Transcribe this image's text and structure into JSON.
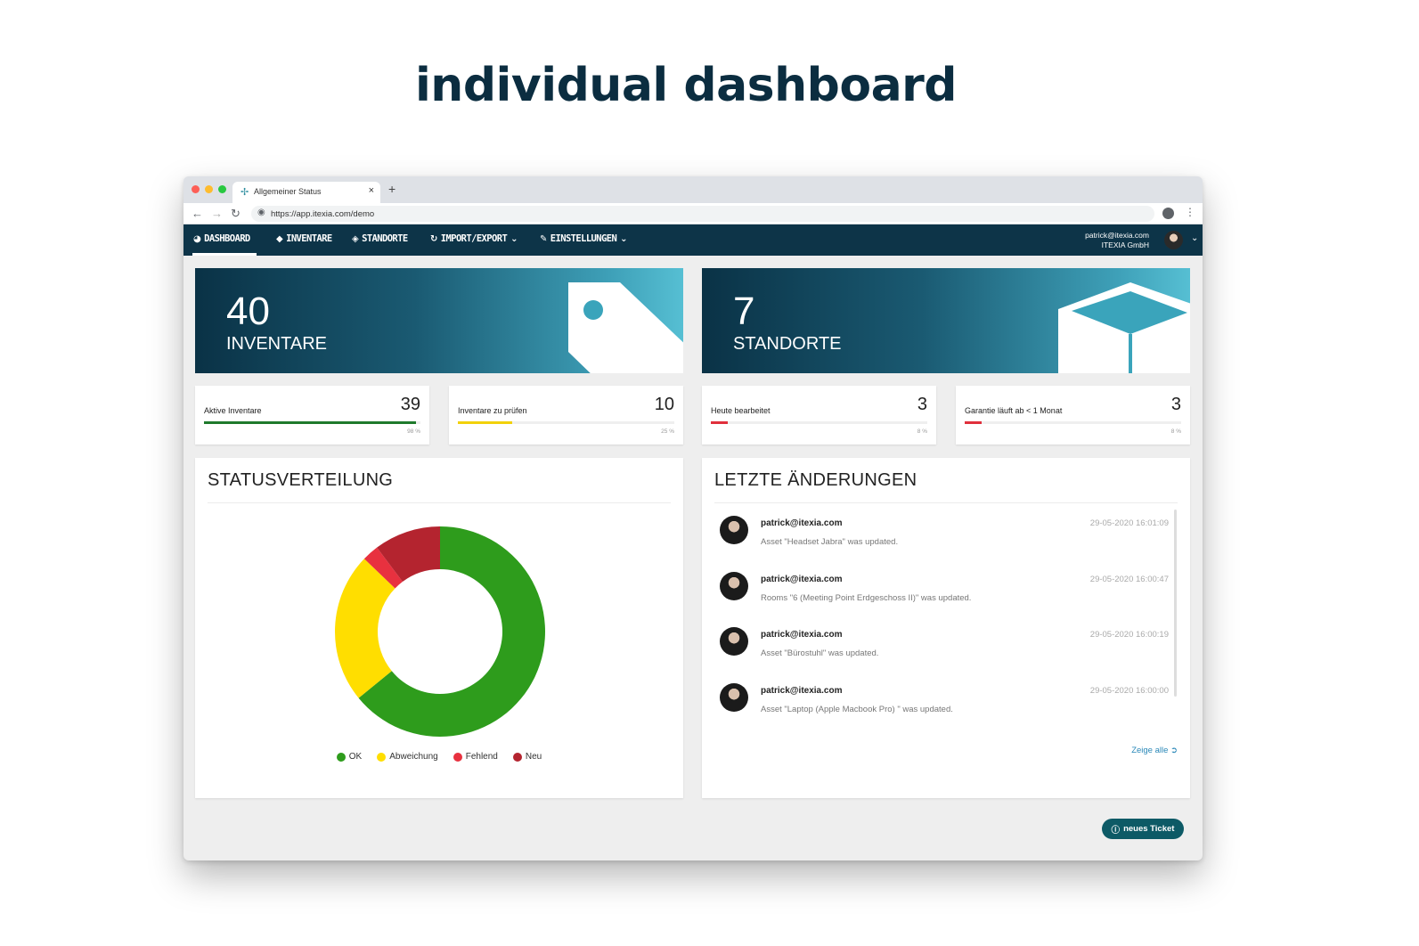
{
  "headline": "individual dashboard",
  "browser": {
    "tab_title": "Allgemeiner Status",
    "tab_close": "×",
    "new_tab": "+",
    "url": "https://app.itexia.com/demo"
  },
  "nav": {
    "items": [
      {
        "label": "DASHBOARD",
        "icon": "◕"
      },
      {
        "label": "INVENTARE",
        "icon": "◆"
      },
      {
        "label": "STANDORTE",
        "icon": "◈"
      },
      {
        "label": "IMPORT/EXPORT",
        "icon": "↻"
      },
      {
        "label": "EINSTELLUNGEN",
        "icon": "✎"
      }
    ],
    "user_email": "patrick@itexia.com",
    "user_company": "ITEXIA GmbH"
  },
  "hero": {
    "inventare": {
      "value": "40",
      "label": "INVENTARE"
    },
    "standorte": {
      "value": "7",
      "label": "STANDORTE"
    }
  },
  "stats": [
    {
      "label": "Aktive Inventare",
      "value": "39",
      "percent_text": "98 %",
      "percent": 98,
      "color": "#1e7a2c"
    },
    {
      "label": "Inventare zu prüfen",
      "value": "10",
      "percent_text": "25 %",
      "percent": 25,
      "color": "#f2d10a"
    },
    {
      "label": "Heute bearbeitet",
      "value": "3",
      "percent_text": "8 %",
      "percent": 8,
      "color": "#e0303c"
    },
    {
      "label": "Garantie läuft ab < 1 Monat",
      "value": "3",
      "percent_text": "8 %",
      "percent": 8,
      "color": "#e0303c"
    }
  ],
  "status_panel": {
    "title": "STATUSVERTEILUNG"
  },
  "chart_data": {
    "type": "pie",
    "donut": true,
    "categories": [
      "OK",
      "Abweichung",
      "Fehlend",
      "Neu"
    ],
    "values": [
      25,
      9,
      1,
      4
    ],
    "colors": [
      "#2e9c1c",
      "#ffde00",
      "#e8313f",
      "#b4242f"
    ]
  },
  "changes_panel": {
    "title": "LETZTE ÄNDERUNGEN",
    "items": [
      {
        "user": "patrick@itexia.com",
        "message": "Asset \"Headset Jabra\" was updated.",
        "time": "29-05-2020 16:01:09"
      },
      {
        "user": "patrick@itexia.com",
        "message": "Rooms \"6 (Meeting Point Erdgeschoss II)\" was updated.",
        "time": "29-05-2020 16:00:47"
      },
      {
        "user": "patrick@itexia.com",
        "message": "Asset \"Bürostuhl\" was updated.",
        "time": "29-05-2020 16:00:19"
      },
      {
        "user": "patrick@itexia.com",
        "message": "Asset \"Laptop (Apple Macbook Pro) \" was updated.",
        "time": "29-05-2020 16:00:00"
      }
    ],
    "show_all": "Zeige alle"
  },
  "ticket_button": "neues Ticket"
}
